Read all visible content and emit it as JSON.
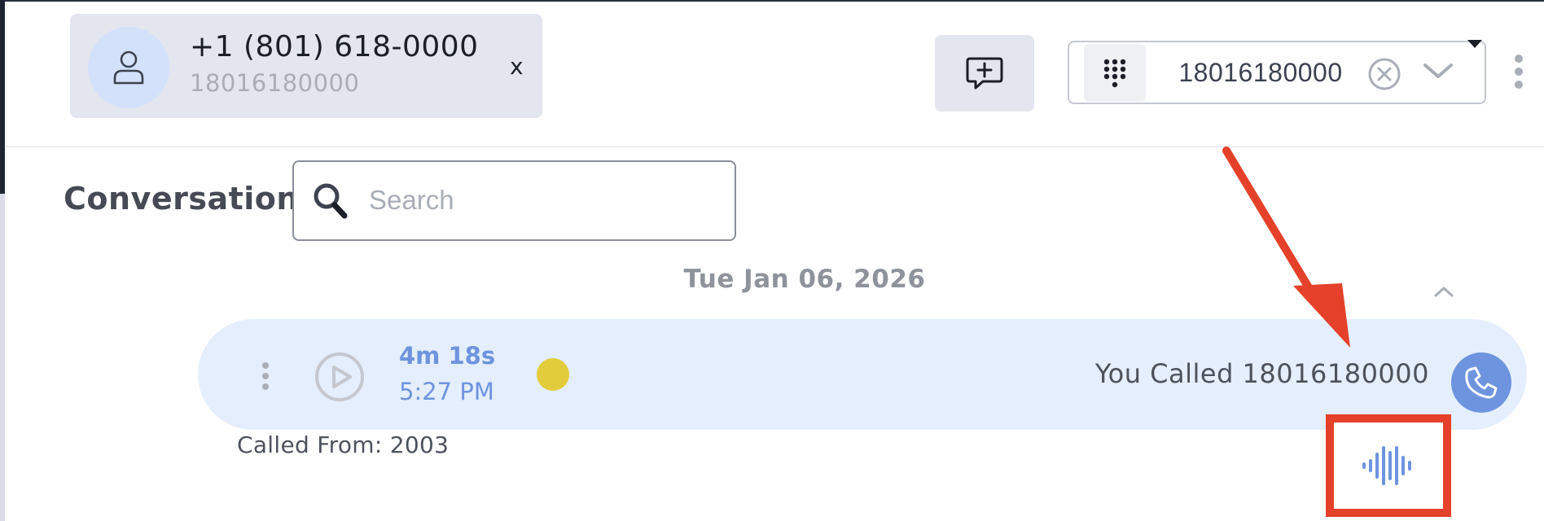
{
  "header": {
    "contact": {
      "name": "+1 (801) 618-0000",
      "number": "18016180000",
      "close_label": "x",
      "avatar_icon": "user-icon"
    },
    "new_message_icon": "message-plus-icon",
    "dialer": {
      "value": "18016180000",
      "dialpad_icon": "dialpad-icon",
      "clear_icon": "clear-circle-icon",
      "dropdown_icon": "chevron-down-icon"
    },
    "more_icon": "vertical-dots-icon"
  },
  "conversation": {
    "title": "Conversation",
    "search": {
      "placeholder": "Search",
      "value": ""
    },
    "date": "Tue Jan 06, 2026",
    "calls": [
      {
        "duration": "4m 18s",
        "time": "5:27 PM",
        "status_color": "#e3cc3c",
        "description": "You Called 18016180000",
        "called_from": "Called From: 2003",
        "transcript_icon": "audio-waveform-icon"
      }
    ]
  },
  "colors": {
    "accent": "#6e94df",
    "row_background": "#e4eefc",
    "chip_background": "#e3e6ee",
    "annotation": "#e5412a"
  }
}
